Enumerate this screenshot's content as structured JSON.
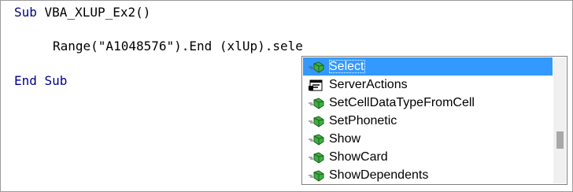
{
  "code": {
    "line1_keyword": "Sub",
    "line1_rest": " VBA_XLUP_Ex2()",
    "line2": "Range(\"A1048576\").End (xlUp).sele",
    "line3_keyword": "End",
    "line3_rest": " Sub"
  },
  "autocomplete": {
    "items": [
      {
        "label": "Select",
        "icon": "method-icon",
        "selected": true
      },
      {
        "label": "ServerActions",
        "icon": "property-icon",
        "selected": false
      },
      {
        "label": "SetCellDataTypeFromCell",
        "icon": "method-icon",
        "selected": false
      },
      {
        "label": "SetPhonetic",
        "icon": "method-icon",
        "selected": false
      },
      {
        "label": "Show",
        "icon": "method-icon",
        "selected": false
      },
      {
        "label": "ShowCard",
        "icon": "method-icon",
        "selected": false
      },
      {
        "label": "ShowDependents",
        "icon": "method-icon",
        "selected": false
      }
    ]
  },
  "colors": {
    "keyword": "#00008b",
    "selection": "#3399ff",
    "method_icon": "#2e8b2e"
  }
}
